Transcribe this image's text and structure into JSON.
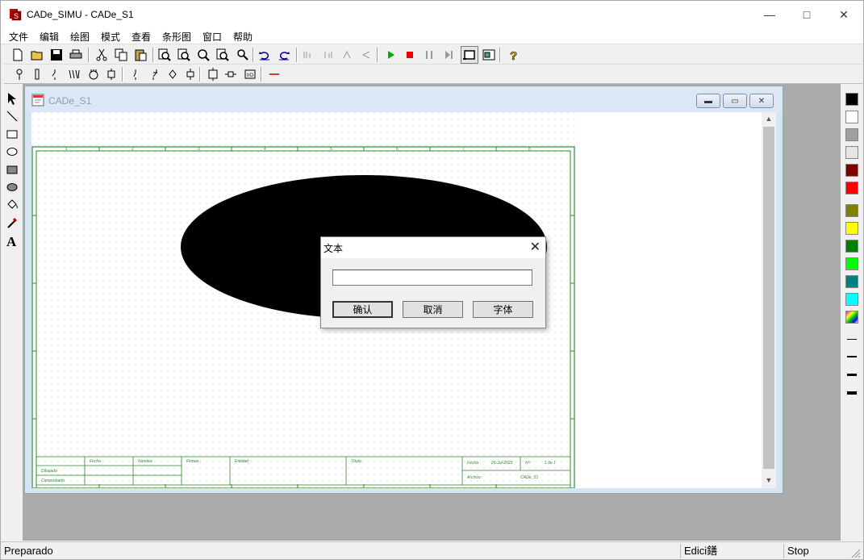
{
  "window": {
    "title": "CADe_SIMU - CADe_S1",
    "minimize": "—",
    "maximize": "□",
    "close": "✕"
  },
  "menu": [
    "文件",
    "编辑",
    "绘图",
    "模式",
    "查看",
    "条形图",
    "窗口",
    "帮助"
  ],
  "child": {
    "title": "CADe_S1"
  },
  "drawing": {
    "title_block": {
      "fecha_col": "Fecha",
      "nombre_col": "Nombre",
      "firmas": "Firmas :",
      "entidad": "Entidad :",
      "titulo": "Título :",
      "dibujado": "Dibujado",
      "comprobado": "Comprobado",
      "fecha_label": "Fecha :",
      "fecha_value": "26-Jul-2023",
      "n_label": "Nº:",
      "n_value": "1 de 1",
      "archivo_label": "Archivo :",
      "archivo_value": "CADe_S1"
    },
    "border_numbers": [
      "1",
      "2",
      "3",
      "4",
      "5",
      "6",
      "7",
      "8"
    ]
  },
  "dialog": {
    "title": "文本",
    "input_value": "",
    "ok": "确认",
    "cancel": "取消",
    "font": "字体"
  },
  "palette": {
    "colors": [
      "#000000",
      "#ffffff",
      "#a0a0a0",
      "#e6e6e6",
      "#800000",
      "#ff0000",
      "#808000",
      "#ffff00",
      "#008000",
      "#00ff00",
      "#008080",
      "#00ffff"
    ]
  },
  "status": {
    "left": "Preparado",
    "mode": "Edici鐥",
    "run": "Stop"
  }
}
